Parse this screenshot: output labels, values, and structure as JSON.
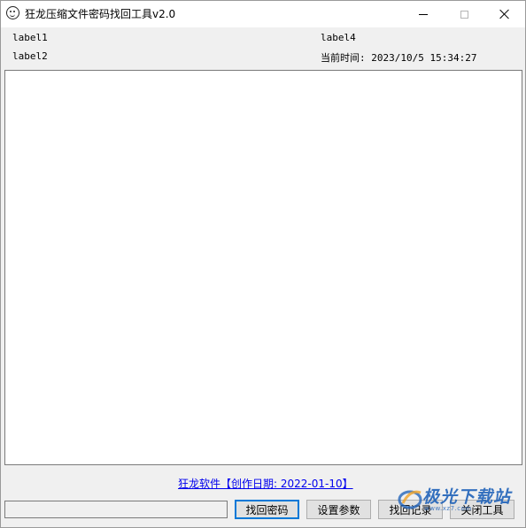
{
  "window": {
    "title": "狂龙压缩文件密码找回工具v2.0"
  },
  "labels": {
    "label1": "label1",
    "label2": "label2",
    "label4": "label4",
    "current_time": "当前时间: 2023/10/5 15:34:27"
  },
  "log_area": {
    "value": ""
  },
  "footer": {
    "link_text": "狂龙软件【创作日期: 2022-01-10】"
  },
  "controls": {
    "password_input_value": "",
    "find_button": "找回密码",
    "settings_button": "设置参数",
    "records_button": "找回记录",
    "close_button": "关闭工具"
  },
  "watermark": {
    "text": "极光下载站",
    "sub": "www.xz7.com"
  },
  "colors": {
    "link": "#0000ee",
    "accent": "#0078d7",
    "watermark": "#1b5fb8"
  }
}
